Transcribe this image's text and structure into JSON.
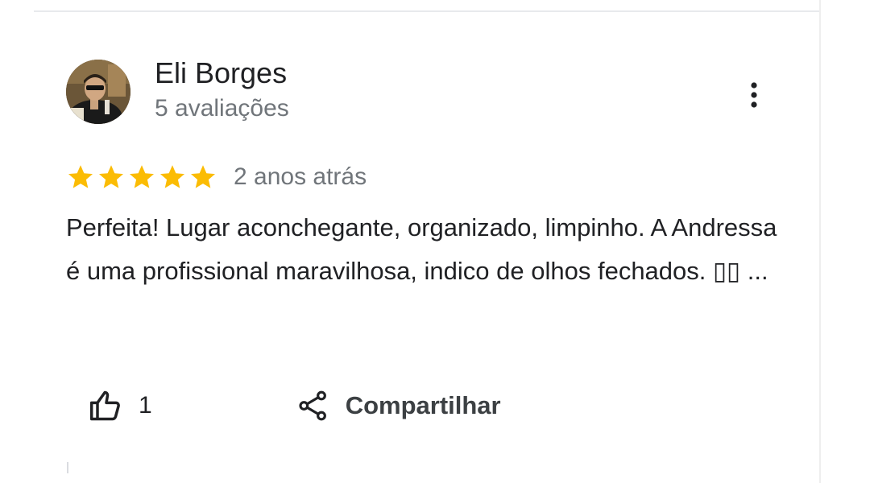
{
  "review": {
    "author": {
      "name": "Eli Borges",
      "meta": "5 avaliações",
      "avatar_icon": "user-photo-avatar"
    },
    "more_icon": "more-vert-icon",
    "rating": 5,
    "rating_max": 5,
    "star_color": "#fbbc04",
    "date": "2 anos atrás",
    "text": "Perfeita! Lugar aconchegante, organizado, limpinho. A Andressa é uma profissional maravilhosa, indico de olhos fechados. ▯▯ ...",
    "actions": {
      "like_icon": "thumb-up-icon",
      "like_count": "1",
      "share_icon": "share-icon",
      "share_label": "Compartilhar"
    }
  }
}
